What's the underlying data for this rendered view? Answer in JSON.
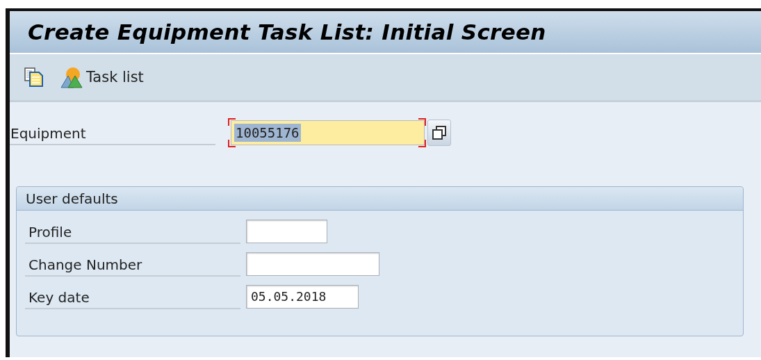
{
  "window": {
    "title": "Create Equipment Task List: Initial Screen"
  },
  "toolbar": [
    {
      "kind": "copy"
    },
    {
      "kind": "tasklist",
      "label": "Task list"
    }
  ],
  "equipment": {
    "label": "Equipment",
    "value": "10055176",
    "required": true,
    "text_selected": true
  },
  "user_defaults": {
    "title": "User defaults",
    "fields": [
      {
        "label": "Profile"
      },
      {
        "label": "Change Number"
      },
      {
        "label": "Key date",
        "value": "05.05.2018"
      }
    ]
  }
}
